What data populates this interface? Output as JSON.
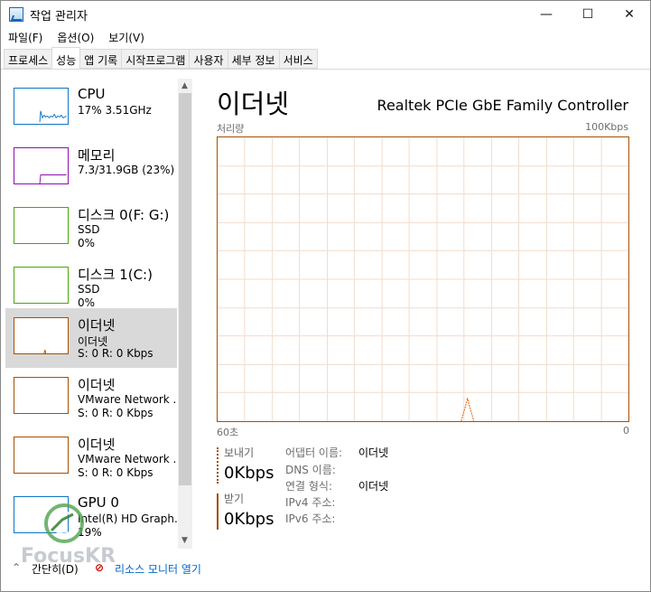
{
  "window": {
    "title": "작업 관리자",
    "controls": {
      "minimize": "—",
      "maximize": "☐",
      "close": "✕"
    }
  },
  "menu": [
    "파일(F)",
    "옵션(O)",
    "보기(V)"
  ],
  "tabs": [
    "프로세스",
    "성능",
    "앱 기록",
    "시작프로그램",
    "사용자",
    "세부 정보",
    "서비스"
  ],
  "sidebar": {
    "items": [
      {
        "title": "CPU",
        "lines": [
          "17% 3.51GHz"
        ],
        "color": "#1174c5"
      },
      {
        "title": "메모리",
        "lines": [
          "7.3/31.9GB (23%)"
        ],
        "color": "#8b12ae"
      },
      {
        "title": "디스크 0(F: G:)",
        "lines": [
          "SSD",
          "0%"
        ],
        "color": "#4da60c"
      },
      {
        "title": "디스크 1(C:)",
        "lines": [
          "SSD",
          "0%"
        ],
        "color": "#4da60c"
      },
      {
        "title": "이더넷",
        "lines": [
          "이더넷",
          "S: 0 R: 0 Kbps"
        ],
        "color": "#a74f01"
      },
      {
        "title": "이더넷",
        "lines": [
          "VMware Network ...",
          "S: 0 R: 0 Kbps"
        ],
        "color": "#a74f01"
      },
      {
        "title": "이더넷",
        "lines": [
          "VMware Network ...",
          "S: 0 R: 0 Kbps"
        ],
        "color": "#a74f01"
      },
      {
        "title": "GPU 0",
        "lines": [
          "Intel(R) HD Graph...",
          "19%"
        ],
        "color": "#1174c5"
      }
    ],
    "selected_index": 4
  },
  "main": {
    "title": "이더넷",
    "adapter": "Realtek PCIe GbE Family Controller",
    "graph": {
      "label": "처리량",
      "max": "100Kbps",
      "time_left": "60초",
      "time_right": "0"
    },
    "send_label": "보내기",
    "send_value": "0Kbps",
    "recv_label": "받기",
    "recv_value": "0Kbps",
    "info": [
      {
        "label": "어댑터 이름:",
        "value": "이더넷"
      },
      {
        "label": "DNS 이름:",
        "value": ""
      },
      {
        "label": "연결 형식:",
        "value": "이더넷"
      },
      {
        "label": "IPv4 주소:",
        "value": ""
      },
      {
        "label": "IPv6 주소:",
        "value": ""
      }
    ]
  },
  "footer": {
    "brief": "간단히(D)",
    "monitor": "리소스 모니터 열기"
  },
  "watermark": "FocusKR"
}
